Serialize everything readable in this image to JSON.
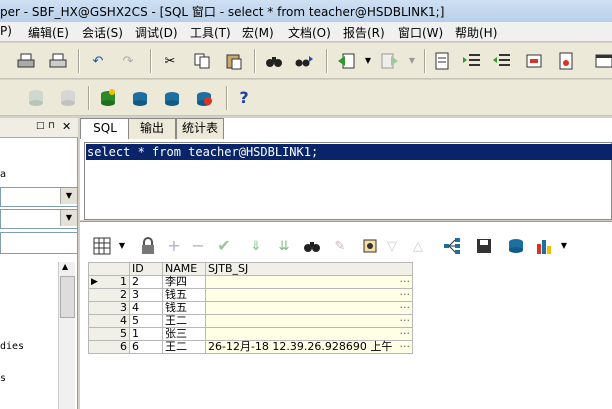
{
  "window": {
    "title": "per - SBF_HX@GSHX2CS - [SQL 窗口 - select * from teacher@HSDBLINK1;]"
  },
  "menu": [
    {
      "label": "P)"
    },
    {
      "label": "编辑(E)"
    },
    {
      "label": "会话(S)"
    },
    {
      "label": "调试(D)"
    },
    {
      "label": "工具(T)"
    },
    {
      "label": "宏(M)"
    },
    {
      "label": "文档(O)"
    },
    {
      "label": "报告(R)"
    },
    {
      "label": "窗口(W)"
    },
    {
      "label": "帮助(H)"
    }
  ],
  "toolbar1_icons": [
    "print-icon",
    "print-preview-icon",
    "undo-icon",
    "redo-icon",
    "cut-icon",
    "copy-icon",
    "paste-icon",
    "find-icon",
    "find-next-icon",
    "import-icon",
    "export-icon",
    "document-icon",
    "indent-icon",
    "unindent-icon",
    "uncomment-icon",
    "page-icon",
    "window-icon"
  ],
  "toolbar2_icons": [
    "db-icon",
    "db-icon",
    "connect-icon",
    "sql-connect-icon",
    "disconnect-icon",
    "refresh-connection-icon",
    "help-icon"
  ],
  "help_glyph": "?",
  "left_panel": {
    "label_a": "a",
    "label_dies": "dies",
    "label_s": "s"
  },
  "tabs": [
    {
      "label": "SQL"
    },
    {
      "label": "输出"
    },
    {
      "label": "统计表"
    }
  ],
  "editor": {
    "sql": "select * from teacher@HSDBLINK1;"
  },
  "grid": {
    "columns": [
      "ID",
      "NAME",
      "SJTB_SJ"
    ],
    "rows": [
      {
        "num": "1",
        "id": "2",
        "name": "李四",
        "sjtb": ""
      },
      {
        "num": "2",
        "id": "3",
        "name": "钱五",
        "sjtb": ""
      },
      {
        "num": "3",
        "id": "4",
        "name": "钱五",
        "sjtb": ""
      },
      {
        "num": "4",
        "id": "5",
        "name": "王二",
        "sjtb": ""
      },
      {
        "num": "5",
        "id": "1",
        "name": "张三",
        "sjtb": ""
      },
      {
        "num": "6",
        "id": "6",
        "name": "王二",
        "sjtb": "26-12月-18 12.39.26.928690 上午"
      }
    ],
    "ellipsis": "···"
  },
  "colors": {
    "selection": "#0a246a",
    "cell_bg": "#ffffe6",
    "toolbar_bg": "#ece9d8"
  }
}
